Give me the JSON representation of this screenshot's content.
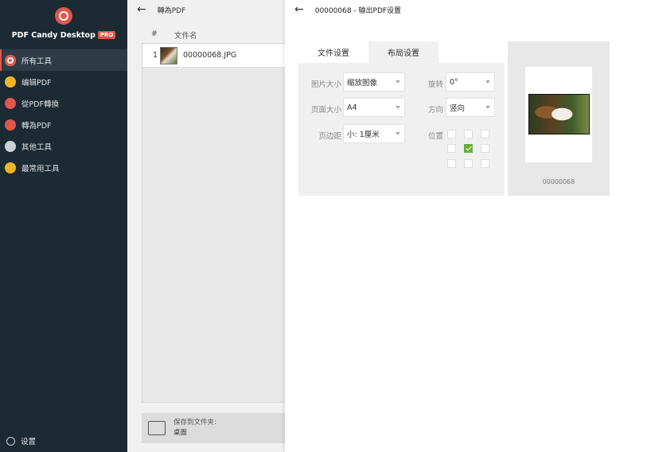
{
  "sidebar": {
    "brand": "PDF Candy Desktop",
    "pro_badge": "PRO",
    "items": [
      {
        "label": "所有工具",
        "icon": "target-icon",
        "color": "#e0574c"
      },
      {
        "label": "编辑PDF",
        "icon": "pencil-icon",
        "color": "#f0b429"
      },
      {
        "label": "從PDF轉換",
        "icon": "arrow-down-icon",
        "color": "#e0574c"
      },
      {
        "label": "轉為PDF",
        "icon": "arrow-up-icon",
        "color": "#e0574c"
      },
      {
        "label": "其他工具",
        "icon": "more-icon",
        "color": "#c9d0d4"
      },
      {
        "label": "最常用工具",
        "icon": "star-icon",
        "color": "#f0b429"
      }
    ],
    "settings_label": "设置"
  },
  "middle": {
    "title": "轉為PDF",
    "col_index": "#",
    "col_name": "文件名",
    "files": [
      {
        "index": "1",
        "name": "00000068.JPG"
      }
    ],
    "save_label": "保存到文件夹:",
    "save_path": "桌面"
  },
  "overlay": {
    "title": "00000068 - 输出PDF设置",
    "tabs": [
      "文件设置",
      "布局设置"
    ],
    "active_tab": 1,
    "fields": {
      "image_size_label": "图片大小",
      "image_size_value": "缩放图像",
      "page_size_label": "页面大小",
      "page_size_value": "A4",
      "margin_label": "页边距",
      "margin_value": "小: 1厘米",
      "rotate_label": "旋转",
      "rotate_value": "0°",
      "orientation_label": "方向",
      "orientation_value": "竖向",
      "position_label": "位置"
    },
    "position_selected": 4,
    "preview_name": "00000068"
  },
  "colors": {
    "accent": "#e0574c",
    "check": "#6aad3a",
    "sidebar_bg": "#1c2a33"
  }
}
